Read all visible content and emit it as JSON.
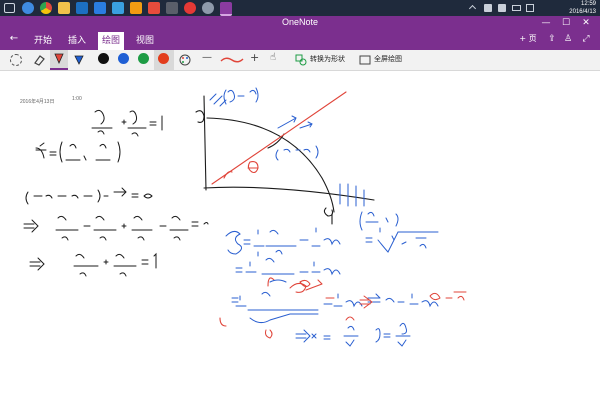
{
  "taskbar": {
    "time": "12:59",
    "date": "2016/4/13"
  },
  "window": {
    "title": "OneNote"
  },
  "ribbon": {
    "tabs": [
      {
        "label": "开始"
      },
      {
        "label": "插入"
      },
      {
        "label": "绘图",
        "active": true
      },
      {
        "label": "视图"
      }
    ],
    "add_page_label": "+ 页"
  },
  "toolbar": {
    "pen_colors": [
      "#111111",
      "#1f5fd4",
      "#1e9c45",
      "#e23c1b"
    ],
    "convert_to_shape": "转换为形状",
    "fullscreen_draw": "全屏绘图"
  },
  "page": {
    "date": "2016年4月13日",
    "time": "1:00"
  },
  "colors": {
    "accent": "#7b2f8e",
    "ink_black": "#1b1b1b",
    "ink_blue": "#2a5fd0",
    "ink_red": "#e0453a"
  }
}
